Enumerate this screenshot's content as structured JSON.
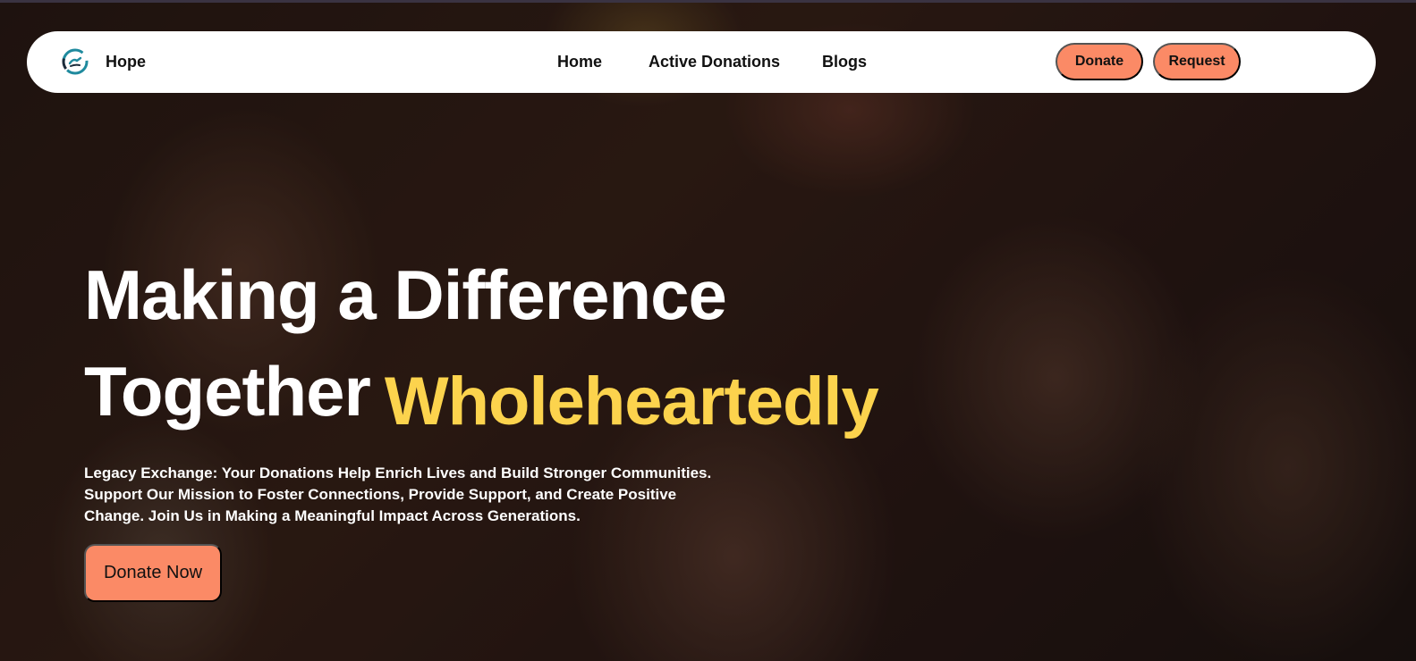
{
  "brand": {
    "name": "Hope",
    "logo_icon": "hands-circle-icon"
  },
  "nav": {
    "links": [
      "Home",
      "Active Donations",
      "Blogs"
    ],
    "donate_label": "Donate",
    "request_label": "Request"
  },
  "hero": {
    "headline_line1": "Making a Difference",
    "headline_line2": "Together",
    "headline_highlight": "Wholeheartedly",
    "subtext_lines": [
      "Legacy Exchange: Your Donations Help Enrich Lives and Build Stronger Communities.",
      "Support Our Mission to Foster Connections, Provide Support, and Create Positive",
      "Change. Join Us in Making a Meaningful Impact Across Generations."
    ],
    "cta_label": "Donate Now"
  },
  "colors": {
    "accent": "#fb8a66",
    "highlight": "#fcd34d",
    "logo_teal": "#1f8a9e",
    "text_dark": "#111111"
  }
}
